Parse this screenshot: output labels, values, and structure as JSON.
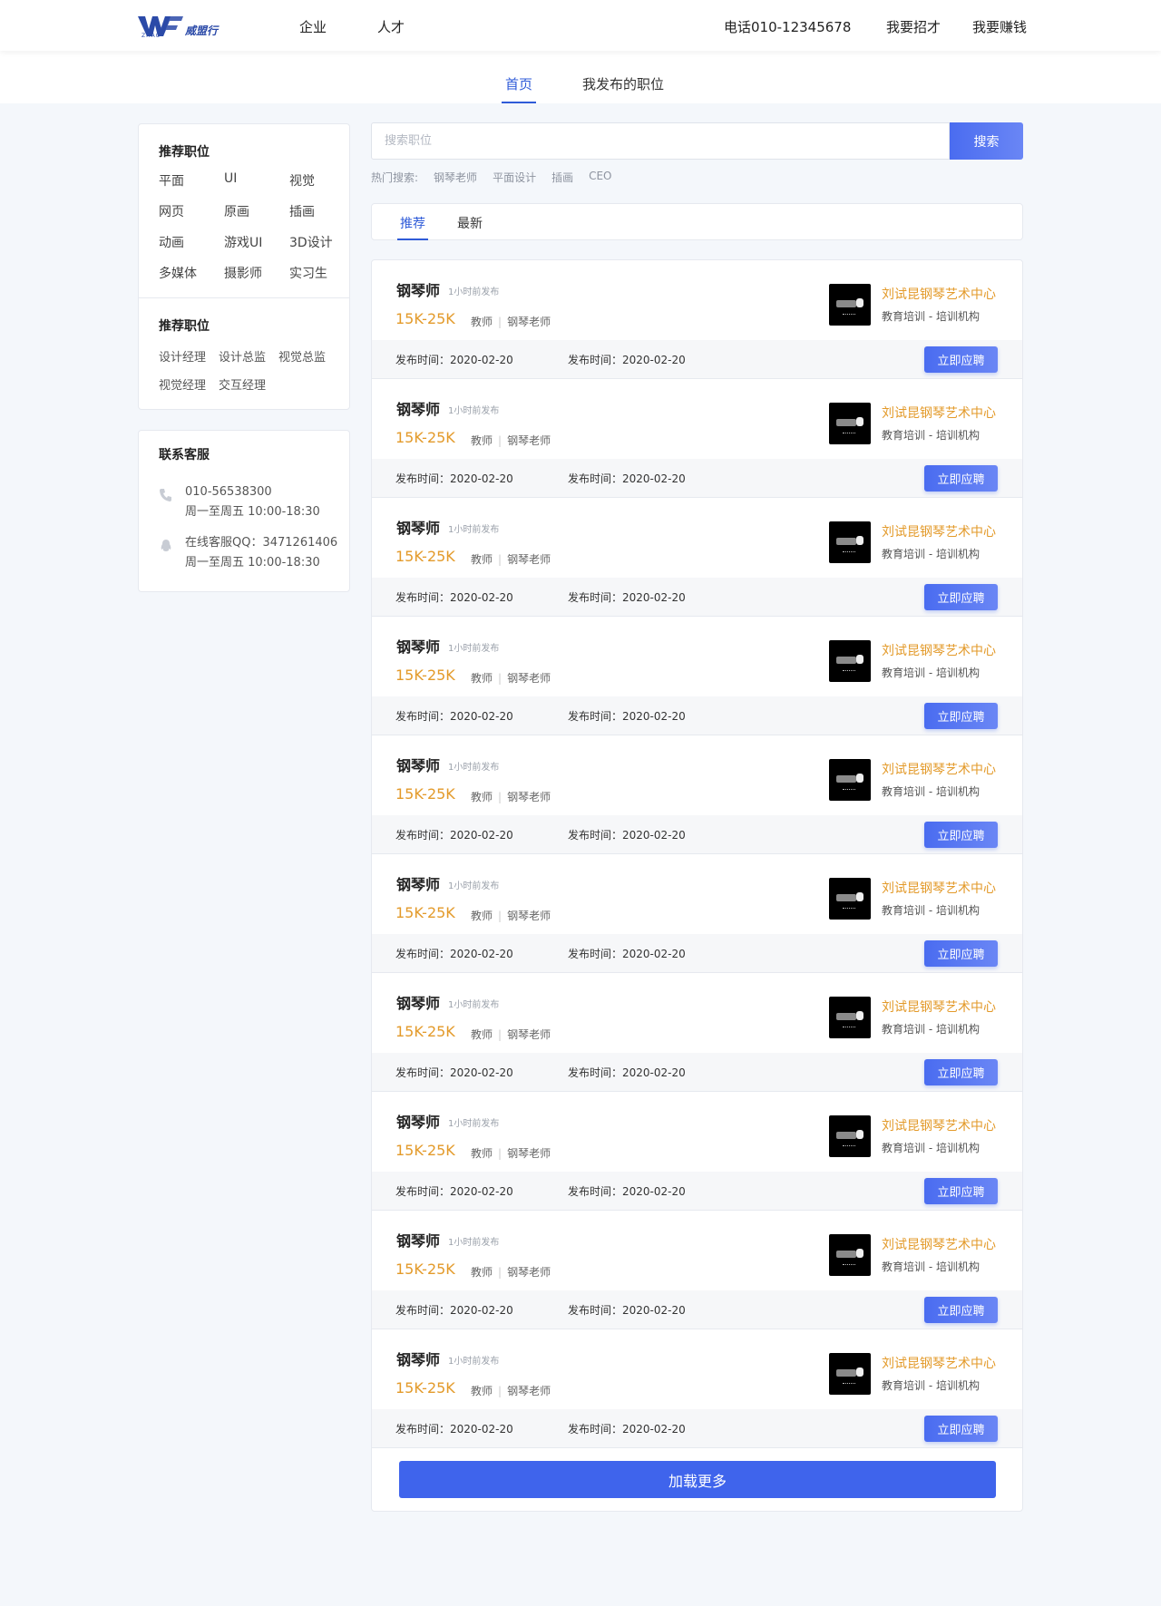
{
  "header": {
    "logo_text": "威盟行",
    "logo_sub": "ZHAO",
    "nav": {
      "qiye": "企业",
      "rencai": "人才"
    },
    "phone": "电话010-12345678",
    "hire": "我要招才",
    "earn": "我要赚钱"
  },
  "subnav": {
    "home": "首页",
    "mine": "我发布的职位"
  },
  "sidebar": {
    "recommended_title": "推荐职位",
    "tags": [
      "平面",
      "UI",
      "视觉",
      "网页",
      "原画",
      "插画",
      "动画",
      "游戏UI",
      "3D设计",
      "多媒体",
      "摄影师",
      "实习生"
    ],
    "recommended_title_2": "推荐职位",
    "small_tags": [
      "设计经理",
      "设计总监",
      "视觉总监",
      "视觉经理",
      "交互经理"
    ],
    "contact_title": "联系客服",
    "phone_line1": "010-56538300",
    "phone_line2": "周一至周五 10:00-18:30",
    "qq_line1": "在线客服QQ：3471261406",
    "qq_line2": "周一至周五 10:00-18:30"
  },
  "search": {
    "placeholder": "搜索职位",
    "button": "搜索"
  },
  "hot": {
    "label": "热门搜索:",
    "items": [
      "钢琴老师",
      "平面设计",
      "插画",
      "CEO"
    ]
  },
  "tabs": {
    "recommend": "推荐",
    "latest": "最新"
  },
  "jobs": [
    {
      "title": "钢琴师",
      "time": "1小时前发布",
      "salary": "15K-25K",
      "tag1": "教师",
      "tag2": "钢琴老师",
      "company": "刘试昆钢琴艺术中心",
      "type": "教育培训 - 培训机构",
      "date1": "发布时间：2020-02-20",
      "date2": "发布时间：2020-02-20",
      "apply": "立即应聘"
    },
    {
      "title": "钢琴师",
      "time": "1小时前发布",
      "salary": "15K-25K",
      "tag1": "教师",
      "tag2": "钢琴老师",
      "company": "刘试昆钢琴艺术中心",
      "type": "教育培训 - 培训机构",
      "date1": "发布时间：2020-02-20",
      "date2": "发布时间：2020-02-20",
      "apply": "立即应聘"
    },
    {
      "title": "钢琴师",
      "time": "1小时前发布",
      "salary": "15K-25K",
      "tag1": "教师",
      "tag2": "钢琴老师",
      "company": "刘试昆钢琴艺术中心",
      "type": "教育培训 - 培训机构",
      "date1": "发布时间：2020-02-20",
      "date2": "发布时间：2020-02-20",
      "apply": "立即应聘"
    },
    {
      "title": "钢琴师",
      "time": "1小时前发布",
      "salary": "15K-25K",
      "tag1": "教师",
      "tag2": "钢琴老师",
      "company": "刘试昆钢琴艺术中心",
      "type": "教育培训 - 培训机构",
      "date1": "发布时间：2020-02-20",
      "date2": "发布时间：2020-02-20",
      "apply": "立即应聘"
    },
    {
      "title": "钢琴师",
      "time": "1小时前发布",
      "salary": "15K-25K",
      "tag1": "教师",
      "tag2": "钢琴老师",
      "company": "刘试昆钢琴艺术中心",
      "type": "教育培训 - 培训机构",
      "date1": "发布时间：2020-02-20",
      "date2": "发布时间：2020-02-20",
      "apply": "立即应聘"
    },
    {
      "title": "钢琴师",
      "time": "1小时前发布",
      "salary": "15K-25K",
      "tag1": "教师",
      "tag2": "钢琴老师",
      "company": "刘试昆钢琴艺术中心",
      "type": "教育培训 - 培训机构",
      "date1": "发布时间：2020-02-20",
      "date2": "发布时间：2020-02-20",
      "apply": "立即应聘"
    },
    {
      "title": "钢琴师",
      "time": "1小时前发布",
      "salary": "15K-25K",
      "tag1": "教师",
      "tag2": "钢琴老师",
      "company": "刘试昆钢琴艺术中心",
      "type": "教育培训 - 培训机构",
      "date1": "发布时间：2020-02-20",
      "date2": "发布时间：2020-02-20",
      "apply": "立即应聘"
    },
    {
      "title": "钢琴师",
      "time": "1小时前发布",
      "salary": "15K-25K",
      "tag1": "教师",
      "tag2": "钢琴老师",
      "company": "刘试昆钢琴艺术中心",
      "type": "教育培训 - 培训机构",
      "date1": "发布时间：2020-02-20",
      "date2": "发布时间：2020-02-20",
      "apply": "立即应聘"
    },
    {
      "title": "钢琴师",
      "time": "1小时前发布",
      "salary": "15K-25K",
      "tag1": "教师",
      "tag2": "钢琴老师",
      "company": "刘试昆钢琴艺术中心",
      "type": "教育培训 - 培训机构",
      "date1": "发布时间：2020-02-20",
      "date2": "发布时间：2020-02-20",
      "apply": "立即应聘"
    },
    {
      "title": "钢琴师",
      "time": "1小时前发布",
      "salary": "15K-25K",
      "tag1": "教师",
      "tag2": "钢琴老师",
      "company": "刘试昆钢琴艺术中心",
      "type": "教育培训 - 培训机构",
      "date1": "发布时间：2020-02-20",
      "date2": "发布时间：2020-02-20",
      "apply": "立即应聘"
    }
  ],
  "load_more": "加载更多",
  "colors": {
    "accent": "#3f64ec",
    "salary": "#e39a2a",
    "background": "#f4f7fb"
  }
}
